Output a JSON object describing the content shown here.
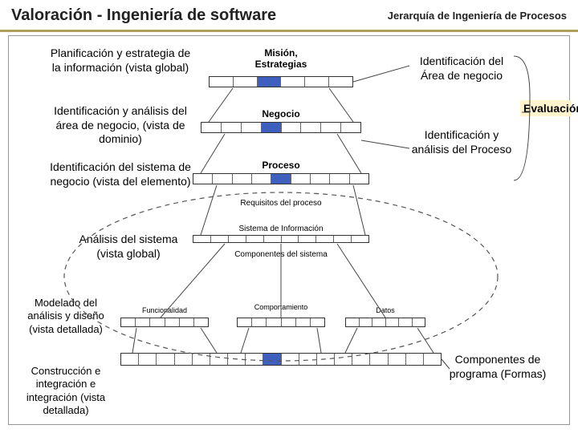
{
  "title": {
    "main": "Valoración - Ingeniería de software",
    "sub": "Jerarquía de Ingeniería de Procesos"
  },
  "left": {
    "planning": "Planificación y estrategia de la información (vista global)",
    "identAnalysis": "Identificación y análisis del área de negocio, (vista de dominio)",
    "identSystem": "Identificación  del sistema de negocio (vista del elemento)",
    "sysAnalysis": "Análisis del sistema (vista global)",
    "modeling": "Modelado del análisis y diseño (vista detallada)",
    "construction": "Construcción e integración e integración (vista detallada)"
  },
  "center": {
    "mision": "Misión,",
    "estrategias": "Estrategias",
    "negocio": "Negocio",
    "proceso": "Proceso",
    "requisitos": "Requisitos del proceso",
    "sistemaInfo": "Sistema de Información",
    "componentes": "Componentes del sistema",
    "funcionalidad": "Funcionalidad",
    "comportamiento": "Comportamiento",
    "datos": "Datos"
  },
  "right": {
    "identArea": "Identificación del Área de negocio",
    "identProceso": "Identificación y análisis  del Proceso",
    "eval": "Evaluación",
    "compProg": "Componentes de programa (Formas)"
  }
}
